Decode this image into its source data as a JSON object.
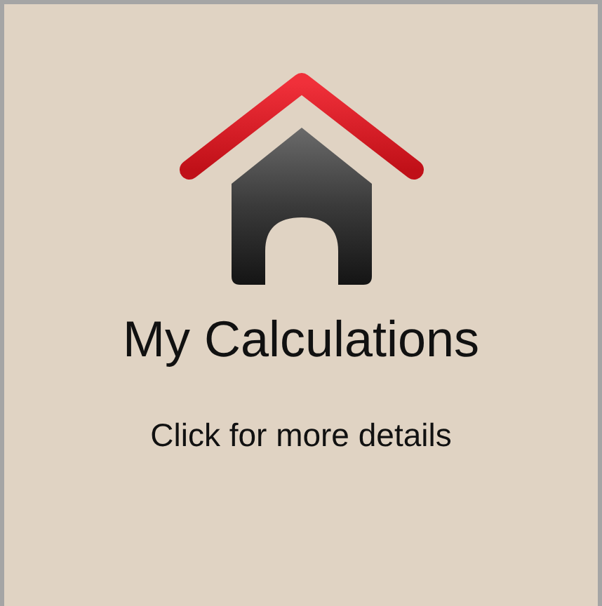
{
  "tile": {
    "title": "My Calculations",
    "subtitle": "Click for more details"
  }
}
